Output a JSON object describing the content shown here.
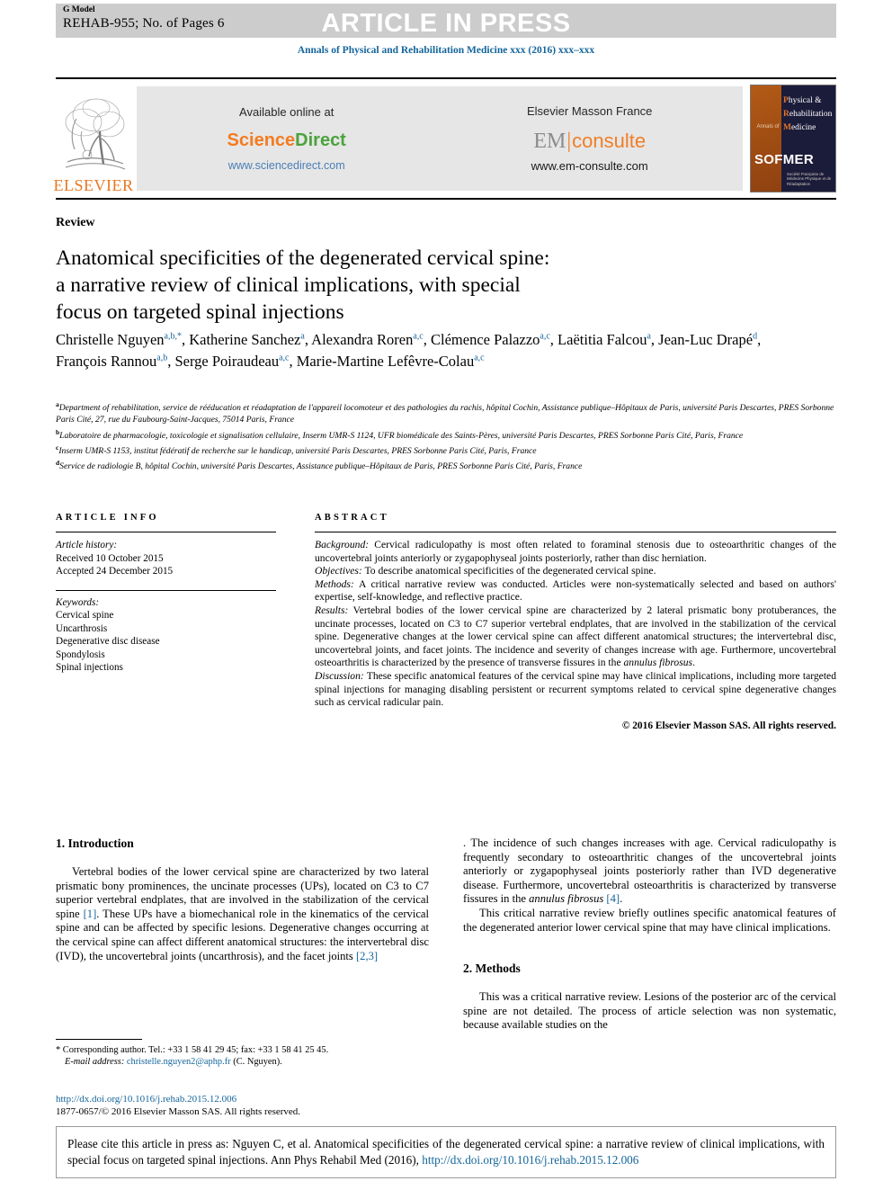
{
  "header": {
    "g_model": "G Model",
    "article_id": "REHAB-955; No. of Pages 6",
    "banner": "ARTICLE IN PRESS",
    "journal_line": "Annals of Physical and Rehabilitation Medicine xxx (2016) xxx–xxx"
  },
  "masthead": {
    "elsevier_wordmark": "ELSEVIER",
    "sciencedirect": {
      "caption": "Available online at",
      "brand_first": "Science",
      "brand_second": "Direct",
      "url": "www.sciencedirect.com"
    },
    "emconsulte": {
      "caption": "Elsevier Masson France",
      "brand_first": "EM",
      "brand_second": "consulte",
      "url": "www.em-consulte.com"
    },
    "cover": {
      "annals_of": "Annals of",
      "line1": "Physical &",
      "line2": "Rehabilitation",
      "line3": "Medicine",
      "society": "SOFMER",
      "society_sub": "Société Française de Médecine Physique et de Réadaptation"
    }
  },
  "article": {
    "type_label": "Review",
    "title_line1": "Anatomical specificities of the degenerated cervical spine:",
    "title_line2": "a narrative review of clinical implications, with special",
    "title_line3": "focus on targeted spinal injections",
    "authors_html": "Christelle Nguyen<sup>a,b,*</sup>, Katherine Sanchez<sup>a</sup>, Alexandra Roren<sup>a,c</sup>, Clémence Palazzo<sup>a,c</sup>, Laëtitia Falcou<sup>a</sup>, Jean-Luc Drapé<sup>d</sup>, François Rannou<sup>a,b</sup>, Serge Poiraudeau<sup>a,c</sup>, Marie-Martine Lefêvre-Colau<sup>a,c</sup>",
    "affiliations": [
      {
        "mark": "a",
        "text": "Department of rehabilitation, service de rééducation et réadaptation de l'appareil locomoteur et des pathologies du rachis, hôpital Cochin, Assistance publique–Hôpitaux de Paris, université Paris Descartes, PRES Sorbonne Paris Cité, 27, rue du Faubourg-Saint-Jacques, 75014 Paris, France"
      },
      {
        "mark": "b",
        "text": "Laboratoire de pharmacologie, toxicologie et signalisation cellulaire, Inserm UMR-S 1124, UFR biomédicale des Saints-Pères, université Paris Descartes, PRES Sorbonne Paris Cité, Paris, France"
      },
      {
        "mark": "c",
        "text": "Inserm UMR-S 1153, institut fédératif de recherche sur le handicap, université Paris Descartes, PRES Sorbonne Paris Cité, Paris, France"
      },
      {
        "mark": "d",
        "text": "Service de radiologie B, hôpital Cochin, université Paris Descartes, Assistance publique–Hôpitaux de Paris, PRES Sorbonne Paris Cité, Paris, France"
      }
    ]
  },
  "article_info": {
    "heading": "ARTICLE INFO",
    "history_label": "Article history:",
    "received": "Received 10 October 2015",
    "accepted": "Accepted 24 December 2015",
    "keywords_label": "Keywords:",
    "keywords": [
      "Cervical spine",
      "Uncarthrosis",
      "Degenerative disc disease",
      "Spondylosis",
      "Spinal injections"
    ]
  },
  "abstract": {
    "heading": "ABSTRACT",
    "sections": [
      {
        "label": "Background:",
        "text": " Cervical radiculopathy is most often related to foraminal stenosis due to osteoarthritic changes of the uncovertebral joints anteriorly or zygapophyseal joints posteriorly, rather than disc herniation."
      },
      {
        "label": "Objectives:",
        "text": " To describe anatomical specificities of the degenerated cervical spine."
      },
      {
        "label": "Methods:",
        "text": " A critical narrative review was conducted. Articles were non-systematically selected and based on authors' expertise, self-knowledge, and reflective practice."
      },
      {
        "label": "Results:",
        "text": " Vertebral bodies of the lower cervical spine are characterized by 2 lateral prismatic bony protuberances, the uncinate processes, located on C3 to C7 superior vertebral endplates, that are involved in the stabilization of the cervical spine. Degenerative changes at the lower cervical spine can affect different anatomical structures; the intervertebral disc, uncovertebral joints, and facet joints. The incidence and severity of changes increase with age. Furthermore, uncovertebral osteoarthritis is characterized by the presence of transverse fissures in the annulus fibrosus."
      },
      {
        "label": "Discussion:",
        "text": " These specific anatomical features of the cervical spine may have clinical implications, including more targeted spinal injections for managing disabling persistent or recurrent symptoms related to cervical spine degenerative changes such as cervical radicular pain."
      }
    ],
    "copyright": "© 2016 Elsevier Masson SAS. All rights reserved."
  },
  "body": {
    "intro_heading": "1. Introduction",
    "intro_p1_a": "Vertebral bodies of the lower cervical spine are characterized by two lateral prismatic bony prominences, the uncinate processes (UPs), located on C3 to C7 superior vertebral endplates, that are involved in the stabilization of the cervical spine ",
    "intro_ref1": "[1]",
    "intro_p1_b": ". These UPs have a biomechanical role in the kinematics of the cervical spine and can be affected by specific lesions. Degenerative changes occurring at the cervical spine can affect different anatomical structures: the intervertebral disc (IVD), the uncovertebral joints (uncarthrosis), and the facet joints ",
    "intro_ref2": "[2,3]",
    "intro_p1_c": ". The incidence of such changes increases with age. Cervical radiculopathy is frequently secondary to osteoarthritic changes of the uncovertebral joints anteriorly or zygapophyseal joints posteriorly rather than IVD degenerative disease. Furthermore, uncovertebral osteoarthritis is characterized by transverse fissures in the ",
    "intro_italic": "annulus fibrosus",
    "intro_ref3": " [4]",
    "intro_p1_d": ".",
    "intro_p2": "This critical narrative review briefly outlines specific anatomical features of the degenerated anterior lower cervical spine that may have clinical implications.",
    "methods_heading": "2. Methods",
    "methods_p1": "This was a critical narrative review. Lesions of the posterior arc of the cervical spine are not detailed. The process of article selection was non systematic, because available studies on the"
  },
  "footnote": {
    "star": "*",
    "corresponding": " Corresponding author. Tel.: +33 1 58 41 29 45; fax: +33 1 58 41 25 45.",
    "email_label": "E-mail address:",
    "email": "christelle.nguyen2@aphp.fr",
    "email_suffix": " (C. Nguyen).",
    "doi": "http://dx.doi.org/10.1016/j.rehab.2015.12.006",
    "issn_line": "1877-0657/© 2016 Elsevier Masson SAS. All rights reserved."
  },
  "citation_box": {
    "text_a": "Please cite this article in press as: Nguyen C, et al. Anatomical specificities of the degenerated cervical spine: a narrative review of clinical implications, with special focus on targeted spinal injections. Ann Phys Rehabil Med (2016), ",
    "link": "http://dx.doi.org/10.1016/j.rehab.2015.12.006"
  },
  "colors": {
    "journal_blue": "#14659b",
    "banner_grey": "#cccccc",
    "panel_grey": "#e6e6e6",
    "elsevier_orange": "#e87722",
    "sciencedirect_green": "#4aa33c",
    "emconsulte_orange": "#f07e26"
  }
}
